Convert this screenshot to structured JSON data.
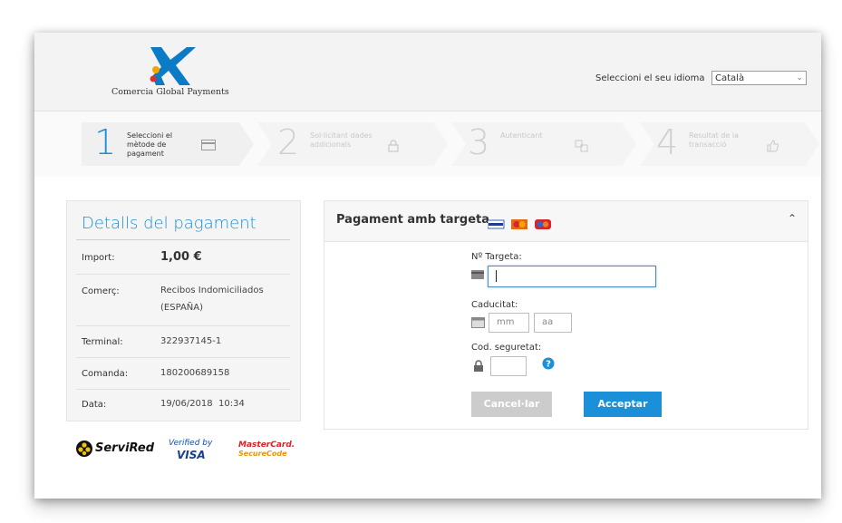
{
  "header": {
    "logo_text": "Comercia Global Payments",
    "language_label": "Seleccioni el seu idioma",
    "language_selected": "Català"
  },
  "steps": [
    {
      "number": "1",
      "label": "Seleccioni el mètode de pagament",
      "icon": "card-icon",
      "state": "active"
    },
    {
      "number": "2",
      "label": "Sol·licitant dades addicionals",
      "icon": "lock-icon",
      "state": "inactive"
    },
    {
      "number": "3",
      "label": "Autenticant",
      "icon": "auth-icon",
      "state": "inactive"
    },
    {
      "number": "4",
      "label": "Resultat de la transacció",
      "icon": "thumbs-up-icon",
      "state": "inactive"
    }
  ],
  "details": {
    "title": "Detalls del pagament",
    "rows": [
      {
        "key": "Import:",
        "value": "1,00 €"
      },
      {
        "key": "Comerç:",
        "value": "Recibos Indomiciliados (ESPAÑA)"
      },
      {
        "key": "Terminal:",
        "value": "322937145-1"
      },
      {
        "key": "Comanda:",
        "value": "180200689158"
      },
      {
        "key": "Data:",
        "value": "19/06/2018  10:34"
      }
    ]
  },
  "brands": {
    "servired": "ServiRed",
    "verified_by": "Verified by",
    "visa": "VISA",
    "mastercard": "MasterCard.",
    "securecode": "SecureCode"
  },
  "payment": {
    "title": "Pagament amb targeta",
    "card_number_label": "Nº Targeta:",
    "card_number_value": "",
    "expiry_label": "Caducitat:",
    "month_placeholder": "mm",
    "year_placeholder": "aa",
    "cvv_label": "Cod. seguretat:",
    "cancel_label": "Cancel·lar",
    "accept_label": "Acceptar"
  },
  "colors": {
    "accent": "#1b8fd7",
    "cancel": "#cccccc",
    "logo_blue": "#0a7bc4",
    "logo_orange": "#f5a300",
    "logo_red": "#e0302a"
  }
}
